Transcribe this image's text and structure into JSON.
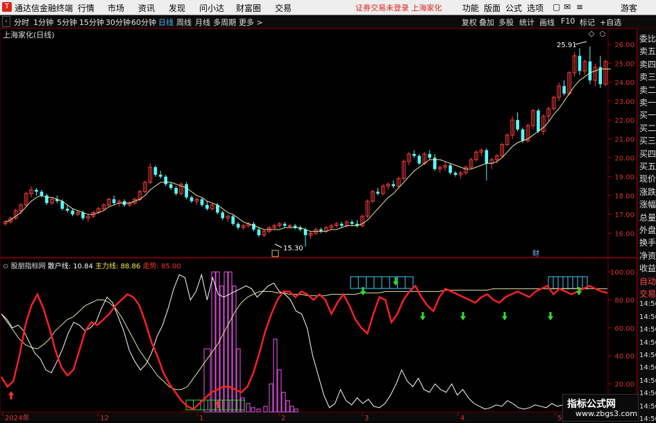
{
  "app": {
    "name": "通达信金融终端",
    "status": "证券交易未登录  上海家化",
    "logo_char": "T",
    "guest": "游客"
  },
  "menu": [
    "行情",
    "市场",
    "资讯",
    "发现",
    "问小达",
    "财富圈",
    "交易"
  ],
  "menu_right": [
    "功能",
    "版面",
    "公式",
    "选项"
  ],
  "periods": [
    "分时",
    "1分钟",
    "5分钟",
    "15分钟",
    "30分钟",
    "60分钟",
    "日线",
    "周线",
    "月线",
    "多周期",
    "更多 >"
  ],
  "toolbar_right": [
    "复权",
    "叠加",
    "多股",
    "统计",
    "画线",
    "F10",
    "标记",
    "+自选"
  ],
  "chart_title": "上海家化(日线)",
  "price_axis": [
    "26.00",
    "25.00",
    "24.00",
    "23.00",
    "22.00",
    "21.00",
    "20.00",
    "19.00",
    "18.00",
    "17.00",
    "16.00"
  ],
  "high_label": "25.91",
  "low_label": "15.30",
  "finance_mark": "财",
  "indicator": {
    "name": "股朋指标网",
    "l1": "散户线: 10.84",
    "l2": "主力线: 88.86",
    "l3": "走势: 85.00"
  },
  "ind_axis": [
    "100.00",
    "80.00",
    "60.00",
    "40.00",
    "20.00"
  ],
  "date_axis": [
    "2024年",
    "12",
    "1",
    "2",
    "3",
    "4",
    "5"
  ],
  "right_panel": [
    "委比",
    "卖五",
    "卖四",
    "卖三",
    "卖二",
    "卖一",
    "买一",
    "买二",
    "买三",
    "买四",
    "买五",
    "现价",
    "涨跌",
    "涨幅",
    "总量",
    "外盘",
    "换手",
    "净资",
    "收益",
    "自动",
    "交易",
    "14:56",
    "14:56",
    "14:56",
    "14:56",
    "14:56",
    "14:56",
    "14:56",
    "14:56",
    "14:56",
    "14:56"
  ],
  "watermark": {
    "big": "指标公式网",
    "small": "www.zbgs3.com"
  },
  "colors": {
    "up": "#ff3b3b",
    "down": "#54ffff",
    "ma": "#e8e8a0",
    "retail": "#ffffff",
    "main": "#ff2020",
    "bar": "#d04ad0"
  },
  "chart_data": {
    "type": "candlestick",
    "ylim": [
      15.5,
      26.3
    ],
    "candles": [
      [
        16.5,
        16.7,
        16.4,
        16.6
      ],
      [
        16.6,
        16.9,
        16.5,
        16.8
      ],
      [
        16.8,
        17.3,
        16.7,
        17.2
      ],
      [
        17.2,
        17.6,
        17.0,
        17.5
      ],
      [
        17.5,
        18.2,
        17.4,
        18.1
      ],
      [
        18.1,
        18.5,
        17.9,
        18.3
      ],
      [
        18.3,
        18.4,
        18.0,
        18.2
      ],
      [
        18.2,
        18.3,
        17.9,
        18.0
      ],
      [
        18.0,
        18.1,
        17.5,
        17.6
      ],
      [
        17.6,
        17.9,
        17.5,
        17.8
      ],
      [
        17.8,
        18.0,
        17.6,
        17.7
      ],
      [
        17.7,
        17.8,
        17.2,
        17.3
      ],
      [
        17.3,
        17.5,
        17.1,
        17.2
      ],
      [
        17.2,
        17.3,
        16.9,
        17.0
      ],
      [
        17.0,
        17.2,
        16.9,
        17.1
      ],
      [
        17.1,
        17.2,
        16.7,
        16.8
      ],
      [
        16.8,
        17.0,
        16.6,
        16.9
      ],
      [
        16.9,
        17.2,
        16.8,
        17.1
      ],
      [
        17.1,
        17.4,
        17.0,
        17.3
      ],
      [
        17.3,
        17.6,
        17.2,
        17.5
      ],
      [
        17.5,
        17.9,
        17.4,
        17.8
      ],
      [
        17.8,
        18.0,
        17.5,
        17.6
      ],
      [
        17.6,
        17.8,
        17.4,
        17.7
      ],
      [
        17.7,
        17.8,
        17.4,
        17.5
      ],
      [
        17.5,
        17.7,
        17.4,
        17.6
      ],
      [
        17.6,
        17.9,
        17.5,
        17.8
      ],
      [
        17.8,
        18.3,
        17.7,
        18.2
      ],
      [
        18.2,
        18.8,
        18.1,
        18.7
      ],
      [
        18.7,
        19.7,
        18.6,
        19.5
      ],
      [
        19.5,
        19.6,
        19.0,
        19.1
      ],
      [
        19.1,
        19.3,
        18.9,
        19.0
      ],
      [
        19.0,
        19.1,
        18.5,
        18.6
      ],
      [
        18.6,
        18.7,
        18.3,
        18.4
      ],
      [
        18.4,
        18.5,
        18.0,
        18.1
      ],
      [
        18.1,
        18.7,
        18.0,
        18.6
      ],
      [
        18.6,
        18.7,
        17.8,
        17.9
      ],
      [
        17.9,
        18.0,
        17.6,
        17.7
      ],
      [
        17.7,
        17.9,
        17.5,
        17.8
      ],
      [
        17.8,
        17.9,
        17.4,
        17.5
      ],
      [
        17.5,
        17.7,
        17.2,
        17.3
      ],
      [
        17.3,
        17.6,
        17.2,
        17.5
      ],
      [
        17.5,
        17.6,
        17.0,
        17.1
      ],
      [
        17.1,
        17.2,
        16.7,
        16.8
      ],
      [
        16.8,
        17.0,
        16.6,
        16.9
      ],
      [
        16.9,
        17.0,
        16.4,
        16.5
      ],
      [
        16.5,
        16.6,
        16.2,
        16.3
      ],
      [
        16.3,
        16.5,
        16.2,
        16.4
      ],
      [
        16.4,
        16.6,
        16.3,
        16.5
      ],
      [
        16.5,
        16.6,
        16.1,
        16.2
      ],
      [
        16.2,
        16.3,
        15.8,
        15.9
      ],
      [
        15.9,
        16.2,
        15.8,
        16.1
      ],
      [
        16.1,
        16.4,
        16.0,
        16.3
      ],
      [
        16.3,
        16.5,
        16.2,
        16.4
      ],
      [
        16.4,
        16.6,
        16.3,
        16.5
      ],
      [
        16.5,
        16.6,
        16.3,
        16.4
      ],
      [
        16.4,
        16.5,
        16.3,
        16.4
      ],
      [
        16.4,
        16.5,
        16.2,
        16.3
      ],
      [
        16.3,
        16.4,
        16.1,
        16.2
      ],
      [
        16.2,
        16.3,
        15.3,
        15.9
      ],
      [
        15.9,
        16.1,
        15.7,
        16.0
      ],
      [
        16.0,
        16.3,
        15.9,
        16.2
      ],
      [
        16.2,
        16.3,
        16.0,
        16.1
      ],
      [
        16.1,
        16.4,
        16.0,
        16.3
      ],
      [
        16.3,
        16.5,
        16.2,
        16.4
      ],
      [
        16.4,
        16.6,
        16.3,
        16.5
      ],
      [
        16.5,
        16.6,
        16.3,
        16.4
      ],
      [
        16.4,
        16.7,
        16.3,
        16.6
      ],
      [
        16.6,
        16.7,
        16.4,
        16.5
      ],
      [
        16.5,
        16.7,
        16.3,
        16.4
      ],
      [
        16.4,
        17.0,
        16.3,
        16.9
      ],
      [
        16.9,
        17.8,
        16.8,
        17.7
      ],
      [
        17.7,
        18.3,
        17.6,
        18.2
      ],
      [
        18.2,
        18.4,
        18.0,
        18.1
      ],
      [
        18.1,
        18.6,
        18.0,
        18.5
      ],
      [
        18.5,
        18.7,
        18.3,
        18.6
      ],
      [
        18.6,
        18.8,
        18.4,
        18.5
      ],
      [
        18.5,
        19.0,
        18.4,
        18.9
      ],
      [
        18.9,
        19.9,
        18.8,
        19.8
      ],
      [
        19.8,
        20.3,
        19.6,
        20.2
      ],
      [
        20.2,
        20.4,
        20.0,
        20.1
      ],
      [
        20.1,
        20.2,
        19.6,
        19.7
      ],
      [
        19.7,
        20.3,
        19.6,
        20.2
      ],
      [
        20.2,
        20.4,
        19.9,
        20.0
      ],
      [
        20.0,
        20.2,
        19.3,
        19.4
      ],
      [
        19.4,
        19.6,
        19.2,
        19.5
      ],
      [
        19.5,
        19.8,
        19.3,
        19.6
      ],
      [
        19.6,
        19.7,
        19.1,
        19.2
      ],
      [
        19.2,
        19.3,
        19.0,
        19.1
      ],
      [
        19.1,
        19.3,
        18.9,
        19.2
      ],
      [
        19.2,
        19.6,
        19.1,
        19.5
      ],
      [
        19.5,
        20.0,
        19.4,
        19.9
      ],
      [
        19.9,
        20.4,
        19.8,
        20.3
      ],
      [
        20.3,
        20.5,
        20.1,
        20.4
      ],
      [
        20.4,
        20.5,
        18.8,
        19.7
      ],
      [
        19.7,
        20.0,
        19.4,
        19.9
      ],
      [
        19.9,
        20.2,
        19.7,
        20.1
      ],
      [
        20.1,
        20.8,
        20.0,
        20.7
      ],
      [
        20.7,
        21.3,
        20.6,
        21.2
      ],
      [
        21.2,
        22.2,
        21.0,
        22.0
      ],
      [
        22.0,
        22.4,
        21.4,
        21.5
      ],
      [
        21.5,
        21.6,
        20.8,
        20.9
      ],
      [
        20.9,
        21.8,
        20.8,
        21.7
      ],
      [
        21.7,
        22.6,
        21.5,
        22.5
      ],
      [
        22.5,
        22.6,
        21.3,
        21.4
      ],
      [
        21.4,
        22.3,
        21.2,
        22.2
      ],
      [
        22.2,
        22.7,
        21.9,
        22.6
      ],
      [
        22.6,
        23.3,
        22.5,
        23.2
      ],
      [
        23.2,
        24.0,
        23.0,
        23.8
      ],
      [
        23.8,
        24.1,
        23.3,
        23.4
      ],
      [
        23.4,
        24.6,
        23.3,
        24.5
      ],
      [
        24.5,
        25.6,
        24.3,
        25.4
      ],
      [
        25.4,
        25.8,
        24.4,
        24.6
      ],
      [
        24.6,
        25.2,
        24.4,
        25.1
      ],
      [
        25.1,
        25.9,
        23.9,
        24.1
      ],
      [
        24.1,
        25.0,
        23.8,
        24.8
      ],
      [
        24.8,
        25.4,
        23.7,
        23.9
      ],
      [
        23.9,
        25.2,
        23.8,
        25.1
      ]
    ],
    "ma": [
      16.6,
      16.7,
      16.9,
      17.1,
      17.4,
      17.7,
      17.9,
      18.0,
      17.9,
      17.9,
      17.8,
      17.7,
      17.5,
      17.3,
      17.2,
      17.1,
      17.0,
      17.0,
      17.1,
      17.2,
      17.4,
      17.5,
      17.6,
      17.6,
      17.6,
      17.7,
      17.8,
      18.0,
      18.3,
      18.5,
      18.7,
      18.7,
      18.7,
      18.6,
      18.5,
      18.4,
      18.2,
      18.0,
      17.9,
      17.7,
      17.6,
      17.5,
      17.3,
      17.1,
      17.0,
      16.8,
      16.6,
      16.5,
      16.4,
      16.3,
      16.2,
      16.2,
      16.2,
      16.2,
      16.3,
      16.3,
      16.3,
      16.3,
      16.2,
      16.1,
      16.1,
      16.1,
      16.1,
      16.2,
      16.2,
      16.3,
      16.4,
      16.4,
      16.4,
      16.5,
      16.7,
      17.0,
      17.3,
      17.6,
      17.9,
      18.1,
      18.4,
      18.7,
      19.0,
      19.3,
      19.5,
      19.7,
      19.9,
      19.9,
      19.9,
      19.8,
      19.7,
      19.6,
      19.5,
      19.4,
      19.4,
      19.5,
      19.6,
      19.7,
      19.7,
      19.8,
      20.0,
      20.3,
      20.6,
      20.8,
      20.9,
      21.0,
      21.2,
      21.4,
      21.6,
      21.9,
      22.3,
      22.6,
      23.0,
      23.4,
      23.8,
      24.1,
      24.3,
      24.5,
      24.6,
      24.7,
      24.7,
      24.7
    ],
    "retail": [
      70,
      66,
      60,
      62,
      58,
      50,
      42,
      38,
      30,
      28,
      36,
      45,
      56,
      64,
      62,
      58,
      60,
      64,
      74,
      82,
      78,
      68,
      58,
      44,
      36,
      30,
      34,
      42,
      54,
      62,
      74,
      88,
      98,
      96,
      80,
      86,
      98,
      80,
      96,
      84,
      82,
      84,
      86,
      88,
      90,
      88,
      82,
      86,
      90,
      92,
      86,
      84,
      80,
      72,
      70,
      60,
      40,
      26,
      12,
      3,
      6,
      16,
      8,
      5,
      10,
      6,
      9,
      4,
      3,
      6,
      12,
      20,
      30,
      22,
      18,
      24,
      16,
      14,
      20,
      16,
      14,
      20,
      12,
      16,
      10,
      6,
      4,
      2,
      3,
      5,
      4,
      8,
      6,
      3,
      2,
      3,
      5,
      4,
      3,
      6,
      4,
      5,
      6,
      4,
      3,
      2,
      4,
      6,
      3,
      5
    ],
    "main": [
      25,
      18,
      22,
      40,
      62,
      76,
      84,
      74,
      60,
      44,
      32,
      26,
      30,
      44,
      58,
      64,
      62,
      66,
      70,
      76,
      80,
      84,
      82,
      76,
      64,
      50,
      40,
      28,
      20,
      14,
      8,
      4,
      2,
      6,
      10,
      14,
      16,
      18,
      18,
      16,
      14,
      18,
      28,
      42,
      58,
      70,
      80,
      86,
      86,
      82,
      86,
      84,
      80,
      84,
      80,
      70,
      78,
      84,
      76,
      66,
      60,
      56,
      70,
      82,
      80,
      64,
      70,
      80,
      86,
      90,
      82,
      76,
      72,
      82,
      88,
      86,
      84,
      82,
      80,
      78,
      82,
      84,
      80,
      78,
      82,
      84,
      86,
      84,
      82,
      86,
      88,
      90,
      84,
      88,
      86,
      84,
      86,
      88,
      90,
      88,
      86,
      85
    ],
    "trend": [
      70,
      64,
      58,
      52,
      48,
      46,
      45,
      48,
      52,
      58,
      62,
      66,
      68,
      72,
      76,
      78,
      80,
      80,
      78,
      74,
      68,
      60,
      52,
      44,
      38,
      32,
      26,
      22,
      18,
      16,
      16,
      18,
      24,
      30,
      36,
      42,
      48,
      56,
      64,
      72,
      78,
      82,
      84,
      86,
      86,
      86,
      85,
      85,
      84,
      84,
      84,
      83,
      83,
      83,
      83,
      84,
      84,
      84,
      84,
      84,
      85,
      85,
      85,
      85,
      86,
      86,
      86,
      86,
      86,
      86,
      86,
      86,
      86,
      86,
      87,
      87,
      87,
      87,
      87,
      87,
      87,
      87,
      88,
      88,
      88,
      88,
      88,
      88,
      88,
      88,
      88,
      88,
      88,
      88,
      88,
      88,
      88,
      88,
      88,
      88,
      88,
      88
    ],
    "bars": [
      [
        294,
        303,
        45
      ],
      [
        305,
        310,
        100
      ],
      [
        311,
        316,
        100
      ],
      [
        317,
        322,
        90
      ],
      [
        323,
        328,
        100
      ],
      [
        329,
        334,
        100
      ],
      [
        335,
        340,
        90
      ],
      [
        341,
        346,
        45
      ],
      [
        347,
        352,
        10
      ],
      [
        355,
        360,
        6
      ],
      [
        362,
        367,
        3
      ],
      [
        370,
        375,
        2
      ],
      [
        380,
        385,
        4
      ],
      [
        388,
        393,
        20
      ],
      [
        394,
        399,
        52
      ],
      [
        400,
        405,
        30
      ],
      [
        406,
        411,
        14
      ],
      [
        412,
        417,
        8
      ],
      [
        418,
        423,
        4
      ],
      [
        424,
        429,
        2
      ]
    ],
    "boxes": [
      [
        268,
        577,
        84,
        14
      ],
      [
        505,
        399,
        90,
        17
      ],
      [
        790,
        399,
        56,
        17
      ]
    ]
  }
}
